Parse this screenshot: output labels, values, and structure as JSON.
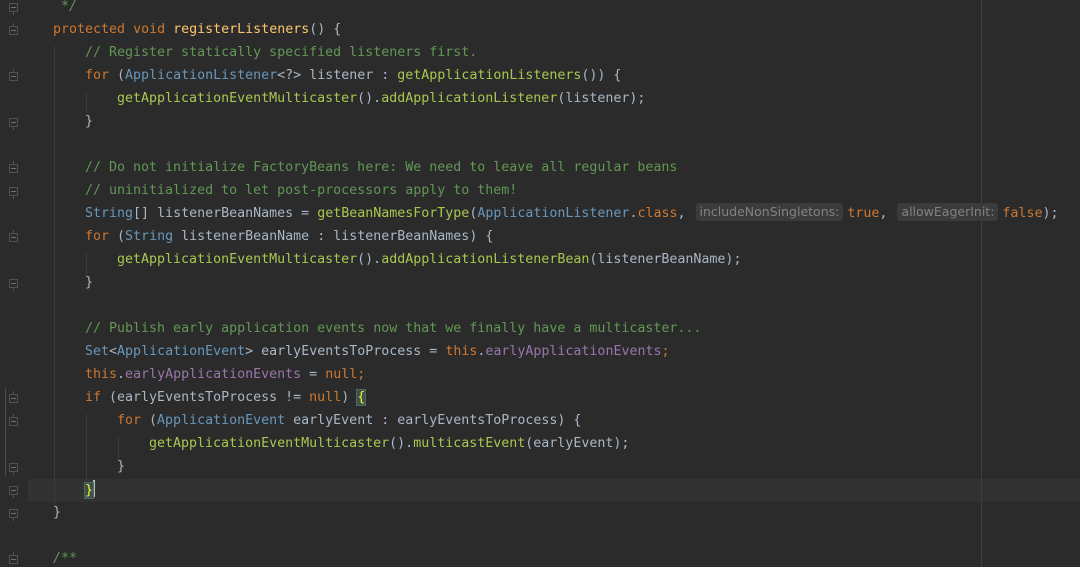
{
  "editor": {
    "language": "java",
    "colors": {
      "background": "#2b2b2b",
      "keyword": "#cc7832",
      "method_declaration": "#ffc66d",
      "method_call": "#a9c74f",
      "type": "#6897bb",
      "comment": "#629755",
      "field": "#9876aa",
      "text": "#a9b7c6",
      "hint_background": "#3b3b3b",
      "hint_text": "#7f8386",
      "brace_match": "#ffef28"
    },
    "lines": {
      "l0": {
        "doc_end": " */"
      },
      "l1": {
        "kw1": "protected",
        "kw2": "void",
        "name": "registerListeners",
        "rest": "() {"
      },
      "l2": {
        "comment": "// Register statically specified listeners first."
      },
      "l3": {
        "kw": "for",
        "open": " (",
        "type": "ApplicationListener",
        "generic": "<?>",
        "var": " listener",
        "colon": " : ",
        "call": "getApplicationListeners",
        "rest": "()) {"
      },
      "l4": {
        "call1": "getApplicationEventMulticaster",
        "mid": "().",
        "call2": "addApplicationListener",
        "rest": "(listener);"
      },
      "l5": {
        "brace": "}"
      },
      "l7": {
        "comment": "// Do not initialize FactoryBeans here: We need to leave all regular beans"
      },
      "l8": {
        "comment": "// uninitialized to let post-processors apply to them!"
      },
      "l9": {
        "type": "String",
        "arr": "[]",
        "var": " listenerBeanNames",
        "eq": " = ",
        "call": "getBeanNamesForType",
        "open": "(",
        "arg_type": "ApplicationListener",
        "dot": ".",
        "kw_class": "class",
        "comma1": ",",
        "hint1": "includeNonSingletons:",
        "val1": "true",
        "comma2": ",",
        "hint2": "allowEagerInit:",
        "val2": "false",
        "close": ");"
      },
      "l10": {
        "kw": "for",
        "open": " (",
        "type": "String",
        "var": " listenerBeanName",
        "colon": " : ",
        "iter": "listenerBeanNames",
        "rest": ") {"
      },
      "l11": {
        "call1": "getApplicationEventMulticaster",
        "mid": "().",
        "call2": "addApplicationListenerBean",
        "rest": "(listenerBeanName);"
      },
      "l12": {
        "brace": "}"
      },
      "l14": {
        "comment": "// Publish early application events now that we finally have a multicaster..."
      },
      "l15": {
        "type": "Set",
        "lt": "<",
        "generic": "ApplicationEvent",
        "gt": ">",
        "var": " earlyEventsToProcess",
        "eq": " = ",
        "kw_this": "this",
        "dot": ".",
        "field": "earlyApplicationEvents",
        "end": ";"
      },
      "l16": {
        "kw_this": "this",
        "dot": ".",
        "field": "earlyApplicationEvents",
        "eq": " = ",
        "kw_null": "null",
        "end": ";"
      },
      "l17": {
        "kw": "if",
        "open": " (",
        "var": "earlyEventsToProcess",
        "op": " != ",
        "kw_null": "null",
        "close": ") ",
        "brace": "{"
      },
      "l18": {
        "kw": "for",
        "open": " (",
        "type": "ApplicationEvent",
        "var": " earlyEvent",
        "colon": " : ",
        "iter": "earlyEventsToProcess",
        "rest": ") {"
      },
      "l19": {
        "call1": "getApplicationEventMulticaster",
        "mid": "().",
        "call2": "multicastEvent",
        "rest": "(earlyEvent);"
      },
      "l20": {
        "brace": "}"
      },
      "l21": {
        "brace": "}"
      },
      "l22": {
        "brace": "}"
      },
      "l24": {
        "doc_start": "/**"
      }
    }
  }
}
